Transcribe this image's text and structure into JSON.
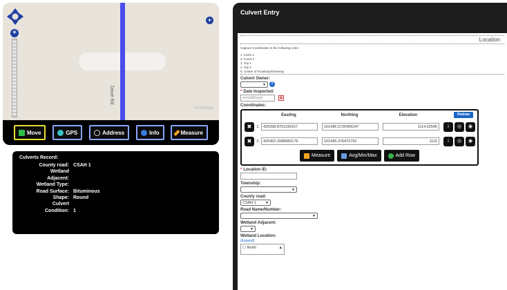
{
  "map": {
    "road_name": "Dove Rd",
    "attribution": "StreetMap"
  },
  "toolbar": {
    "buttons": [
      {
        "label": "Move",
        "icon": "move-icon",
        "active": true
      },
      {
        "label": "GPS",
        "icon": "gps-icon",
        "active": false
      },
      {
        "label": "Address",
        "icon": "search-icon",
        "active": false
      },
      {
        "label": "Info",
        "icon": "info-icon",
        "active": false
      },
      {
        "label": "Measure",
        "icon": "pencil-icon",
        "active": false
      }
    ]
  },
  "record": {
    "title": "Culverts Record:",
    "rows": [
      {
        "key": "County road:",
        "value": "CSAH 1"
      },
      {
        "key": "Wetland",
        "value": ""
      },
      {
        "key": "Adjacent:",
        "value": ""
      },
      {
        "key": "Wetland Type:",
        "value": ""
      },
      {
        "key": "Road Surface:",
        "value": "Bituminous"
      },
      {
        "key": "Shape:",
        "value": "Round"
      },
      {
        "key": "Culvert",
        "value": ""
      },
      {
        "key": "Condition:",
        "value": "1"
      }
    ]
  },
  "culvert": {
    "title": "Culvert Entry",
    "location_header": "Location",
    "instructions": "Capture Coordinates in the following order",
    "order": [
      "1. Invert 1",
      "2. Invert 2",
      "3. Top 1",
      "4. Top 2",
      "5. Center of Roadway/Driveway"
    ],
    "owner_label": "Culvert Owner:",
    "date_label": "Date Inspected:",
    "date_placeholder": "mm/dd/yyyy",
    "coords_label": "Coordinates:",
    "columns": [
      "Easting",
      "Northing",
      "Elevation"
    ],
    "redraw_label": "Redraw",
    "coordinates": [
      {
        "num": "1.",
        "easting": "425398.8751196167",
        "northing": "101495.5725455247",
        "elevation": "1114.02545"
      },
      {
        "num": "2.",
        "easting": "425452.2688080179",
        "northing": "101495.376472792",
        "elevation": "1115"
      }
    ],
    "actions": [
      {
        "label": "Measure",
        "color": "#f5a623"
      },
      {
        "label": "Avg/Min/Max",
        "color": "#6a9be0"
      },
      {
        "label": "Add Row",
        "color": "#35b34a"
      }
    ],
    "location_id_label": "Location ID:",
    "township_label": "Township:",
    "county_road_label": "County road:",
    "county_road_value": "CSAH 1",
    "road_name_label": "Road Name/Number:",
    "wetland_adjacent_label": "Wetland Adjacent:",
    "wetland_location_label": "Wetland Location:",
    "expand_label": "(Expand)",
    "wetland_option": "North"
  }
}
